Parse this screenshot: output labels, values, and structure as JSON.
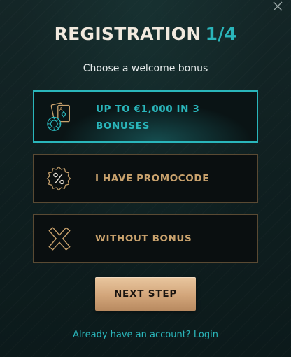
{
  "header": {
    "title": "REGISTRATION",
    "step": "1/4",
    "subtitle": "Choose a welcome bonus"
  },
  "options": [
    {
      "label": "UP TO €1,000 IN 3 BONUSES",
      "icon": "casino-cards-chip-icon",
      "selected": true
    },
    {
      "label": "I HAVE PROMOCODE",
      "icon": "percent-badge-icon",
      "selected": false
    },
    {
      "label": "WITHOUT BONUS",
      "icon": "x-cross-icon",
      "selected": false
    }
  ],
  "actions": {
    "next_label": "NEXT STEP"
  },
  "footer": {
    "question": "Already have an account?",
    "login_label": "Login"
  },
  "colors": {
    "accent_teal": "#2ab6bb",
    "gold": "#c9a26d",
    "button_gold": "#d2a57a",
    "background": "#132526"
  }
}
